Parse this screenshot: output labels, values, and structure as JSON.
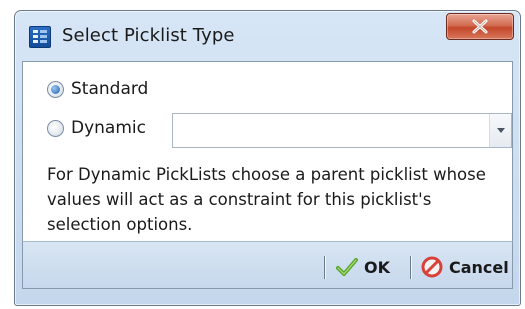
{
  "window": {
    "title": "Select Picklist Type",
    "close_glyph": "X"
  },
  "options": {
    "standard_label": "Standard",
    "standard_selected": true,
    "dynamic_label": "Dynamic",
    "dynamic_selected": false,
    "parent_picklist_value": ""
  },
  "info_text": "For Dynamic PickLists choose a parent picklist whose values will act as a constraint for this picklist's selection options.",
  "buttons": {
    "ok_label": "OK",
    "cancel_label": "Cancel"
  },
  "icons": {
    "app": "picklist-app-icon",
    "close": "close-icon",
    "ok": "checkmark-icon",
    "cancel": "cancel-icon",
    "dropdown": "chevron-down-icon"
  },
  "colors": {
    "ok_check": "#5aa62b",
    "cancel_red": "#d8413a",
    "close_red": "#c4472b"
  }
}
